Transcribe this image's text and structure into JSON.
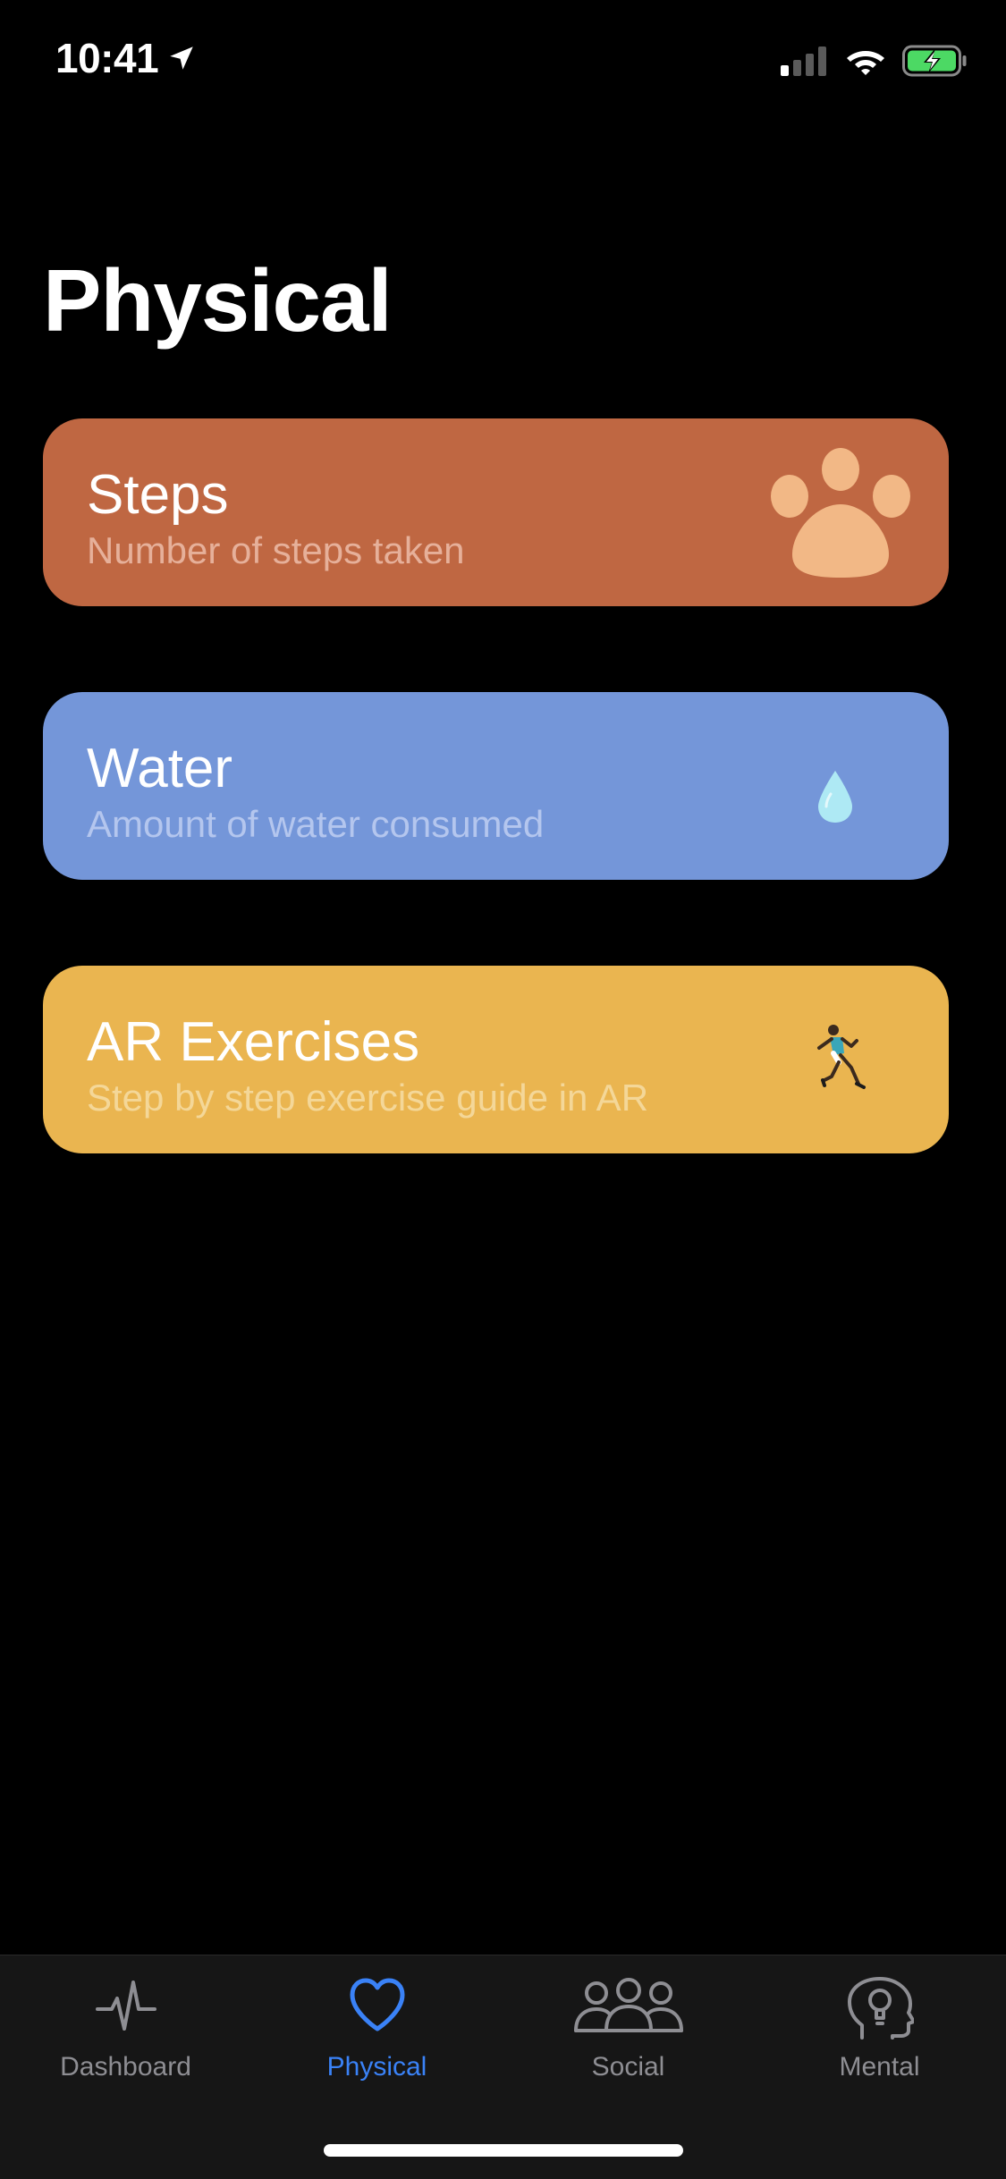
{
  "status_bar": {
    "time": "10:41",
    "icons": [
      "location-arrow-icon",
      "cellular-signal-icon",
      "wifi-icon",
      "battery-charging-icon"
    ]
  },
  "page": {
    "title": "Physical"
  },
  "cards": [
    {
      "title": "Steps",
      "subtitle": "Number of steps taken",
      "icon": "paw-print-icon",
      "background": "#bf6742",
      "subtitle_color": "#e6b09a"
    },
    {
      "title": "Water",
      "subtitle": "Amount of water consumed",
      "icon": "water-drop-icon",
      "background": "#7496d9",
      "subtitle_color": "#b4c6ee"
    },
    {
      "title": "AR Exercises",
      "subtitle": "Step by step exercise guide in AR",
      "icon": "runner-icon",
      "background": "#eab550",
      "subtitle_color": "#f4d798"
    }
  ],
  "tab_bar": {
    "tabs": [
      {
        "label": "Dashboard",
        "icon": "heartbeat-icon",
        "active": false
      },
      {
        "label": "Physical",
        "icon": "heart-icon",
        "active": true
      },
      {
        "label": "Social",
        "icon": "people-group-icon",
        "active": false
      },
      {
        "label": "Mental",
        "icon": "head-lightbulb-icon",
        "active": false
      }
    ],
    "active_color": "#3a82f7",
    "inactive_color": "#8e8e93"
  }
}
